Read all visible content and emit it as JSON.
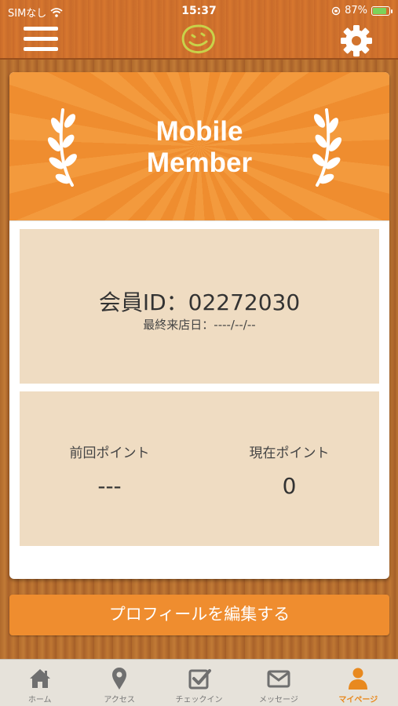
{
  "status_bar": {
    "carrier": "SIMなし",
    "time": "15:37",
    "battery": "87%"
  },
  "card": {
    "banner_title_line1": "Mobile",
    "banner_title_line2": "Member",
    "member_id": "会員ID：02272030",
    "last_visit": "最終来店日：----/--/--",
    "previous_points_label": "前回ポイント",
    "previous_points_value": "---",
    "current_points_label": "現在ポイント",
    "current_points_value": "0"
  },
  "edit_button": {
    "label": "プロフィールを編集する"
  },
  "tabs": [
    {
      "label": "ホーム",
      "icon": "home-icon"
    },
    {
      "label": "アクセス",
      "icon": "map-pin-icon"
    },
    {
      "label": "チェックイン",
      "icon": "checkin-icon"
    },
    {
      "label": "メッセージ",
      "icon": "mail-icon"
    },
    {
      "label": "マイページ",
      "icon": "user-icon",
      "active": true
    }
  ],
  "colors": {
    "accent": "#ef8d2f",
    "header": "#d7772f",
    "panel": "#efdcc2",
    "tab_active": "#e8891f"
  }
}
